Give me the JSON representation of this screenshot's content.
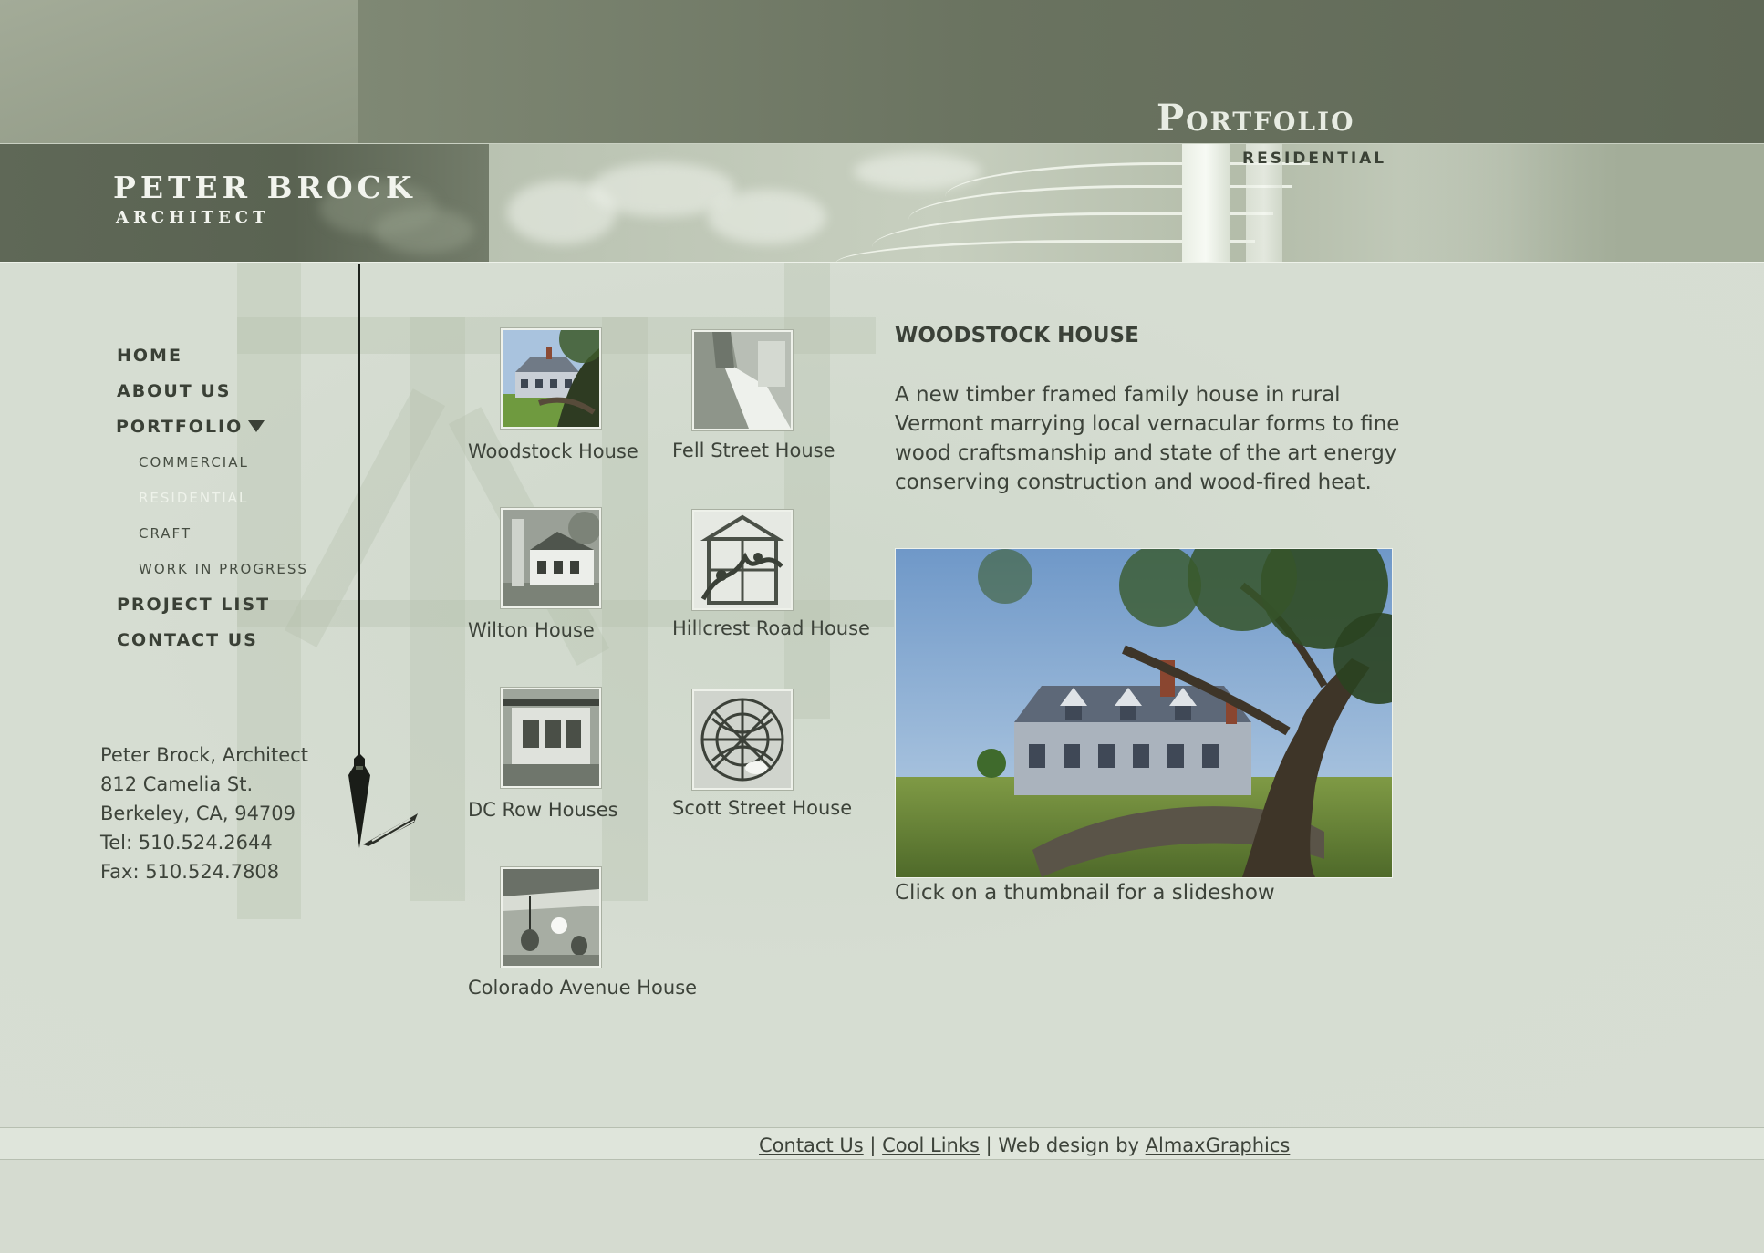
{
  "brand": {
    "name": "Peter Brock",
    "subtitle": "Architect"
  },
  "header": {
    "section": "Portfolio",
    "subsection": "Residential"
  },
  "nav": {
    "home": "HOME",
    "about": "ABOUT US",
    "portfolio": "PORTFOLIO",
    "commercial": "COMMERCIAL",
    "residential": "RESIDENTIAL",
    "craft": "CRAFT",
    "wip": "WORK IN PROGRESS",
    "projects": "PROJECT LIST",
    "contact": "CONTACT US"
  },
  "address": {
    "line1": "Peter Brock, Architect",
    "line2": "812 Camelia St.",
    "line3": "Berkeley, CA, 94709",
    "line4": "Tel: 510.524.2644",
    "line5": "Fax: 510.524.7808"
  },
  "thumbs": [
    {
      "label": "Woodstock House"
    },
    {
      "label": "Fell Street House"
    },
    {
      "label": "Wilton House"
    },
    {
      "label": "Hillcrest Road House"
    },
    {
      "label": "DC Row Houses"
    },
    {
      "label": "Scott Street House"
    },
    {
      "label": "Colorado Avenue House"
    }
  ],
  "detail": {
    "title": "WOODSTOCK HOUSE",
    "description": "A new timber framed family house in rural Vermont marrying local vernacular forms to fine wood craftsmanship and state of the art energy conserving construction and wood-fired heat.",
    "caption": "Click on a thumbnail for a slideshow"
  },
  "footer": {
    "contact": "Contact Us",
    "sep1": " | ",
    "links": "Cool Links",
    "sep2": " | Web design by ",
    "designer": "AlmaxGraphics"
  },
  "colors": {
    "header_dark": "#5f6856",
    "header_light": "#a3ab98",
    "background": "#d5dbd0",
    "text": "#3d433a",
    "nav_active": "#eef2ea"
  }
}
